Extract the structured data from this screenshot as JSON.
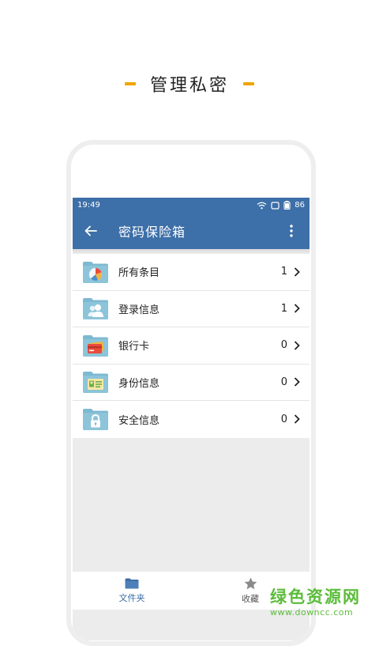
{
  "headline": {
    "text": "管理私密"
  },
  "statusbar": {
    "time": "19:49",
    "battery": "86"
  },
  "appbar": {
    "title": "密码保险箱"
  },
  "list": [
    {
      "label": "所有条目",
      "count": "1",
      "icon": "pie-chart-folder-icon"
    },
    {
      "label": "登录信息",
      "count": "1",
      "icon": "user-folder-icon"
    },
    {
      "label": "银行卡",
      "count": "0",
      "icon": "bank-card-folder-icon"
    },
    {
      "label": "身份信息",
      "count": "0",
      "icon": "id-card-folder-icon"
    },
    {
      "label": "安全信息",
      "count": "0",
      "icon": "lock-folder-icon"
    }
  ],
  "bottomnav": {
    "folders": {
      "label": "文件夹",
      "icon": "folder-icon"
    },
    "favorites": {
      "label": "收藏",
      "icon": "star-icon"
    }
  },
  "watermark": {
    "title": "绿色资源网",
    "url": "www.downcc.com"
  },
  "colors": {
    "primary": "#3d6fa8",
    "accent": "#f0a500",
    "folder": "#7db9d0",
    "watermark": "#5bbd3a"
  }
}
